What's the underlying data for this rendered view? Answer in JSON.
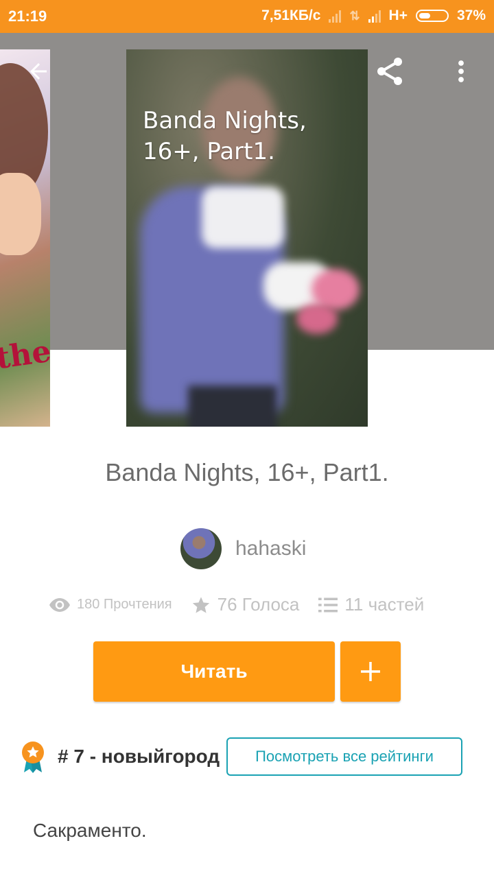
{
  "status_bar": {
    "time": "21:19",
    "network_speed": "7,51КБ/с",
    "network_type": "H+",
    "battery": "37%"
  },
  "toolbar": {
    "back_icon": "arrow-left-icon",
    "share_icon": "share-icon",
    "more_icon": "more-vert-icon"
  },
  "cover": {
    "title_text": "Banda Nights,\n16+, Part1."
  },
  "story": {
    "title": "Banda Nights, 16+, Part1.",
    "author": "hahaski",
    "reads": "180 Прочтения",
    "votes": "76 Голоса",
    "parts": "11 частей"
  },
  "actions": {
    "read_label": "Читать",
    "add_label": "+"
  },
  "ranking": {
    "text": "# 7 - новыйгород",
    "view_all_label": "Посмотреть все рейтинги"
  },
  "description": "Сакраменто.",
  "colors": {
    "accent": "#f7931e",
    "button": "#ff9a12",
    "link": "#1aa2b3",
    "hero_bg": "#8f8d8b"
  }
}
